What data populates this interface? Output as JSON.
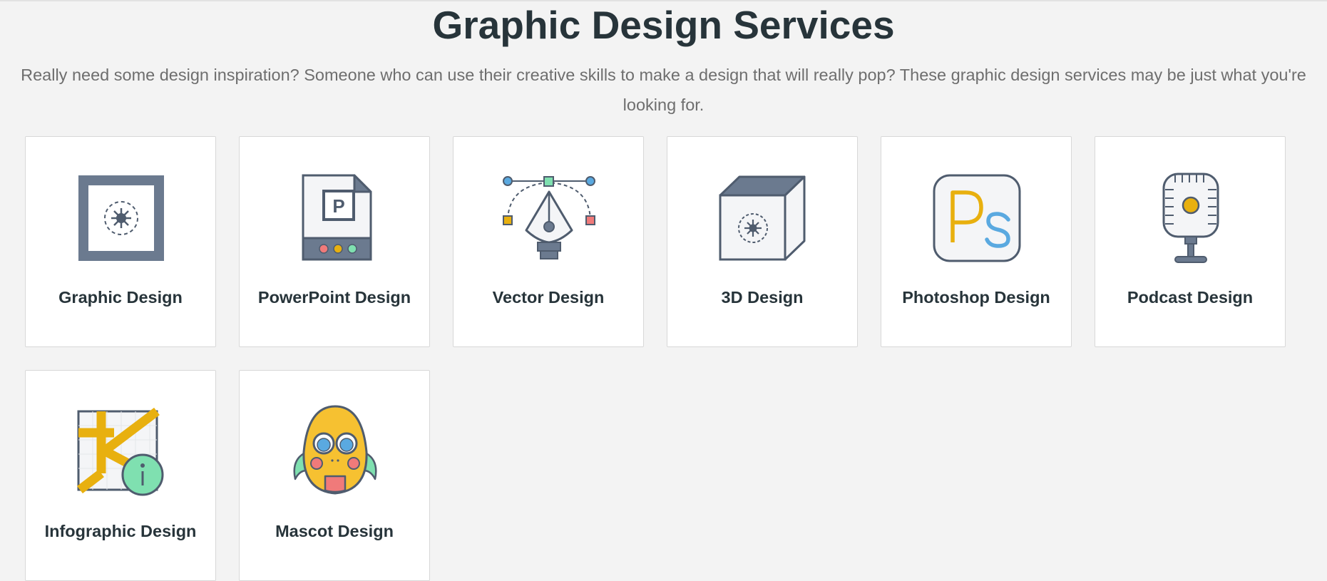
{
  "header": {
    "title": "Graphic Design Services",
    "intro": "Really need some design inspiration? Someone who can use their creative skills to make a design that will really pop? These graphic design services may be just what you're looking for."
  },
  "colors": {
    "background": "#f3f3f3",
    "card": "#ffffff",
    "icon_slate": "#6b7a8f",
    "icon_outline": "#4f5c6e",
    "accent_yellow": "#e8b00f",
    "accent_blue": "#5aa9e0",
    "accent_green": "#7fe0b0",
    "accent_red": "#f07a7a"
  },
  "services": [
    {
      "label": "Graphic Design",
      "icon": "framed-starburst-icon"
    },
    {
      "label": "PowerPoint Design",
      "icon": "powerpoint-file-icon"
    },
    {
      "label": "Vector Design",
      "icon": "pen-tool-icon"
    },
    {
      "label": "3D Design",
      "icon": "cube-icon"
    },
    {
      "label": "Photoshop Design",
      "icon": "photoshop-icon"
    },
    {
      "label": "Podcast Design",
      "icon": "microphone-icon"
    },
    {
      "label": "Infographic Design",
      "icon": "map-info-icon"
    },
    {
      "label": "Mascot Design",
      "icon": "mascot-creature-icon"
    }
  ]
}
